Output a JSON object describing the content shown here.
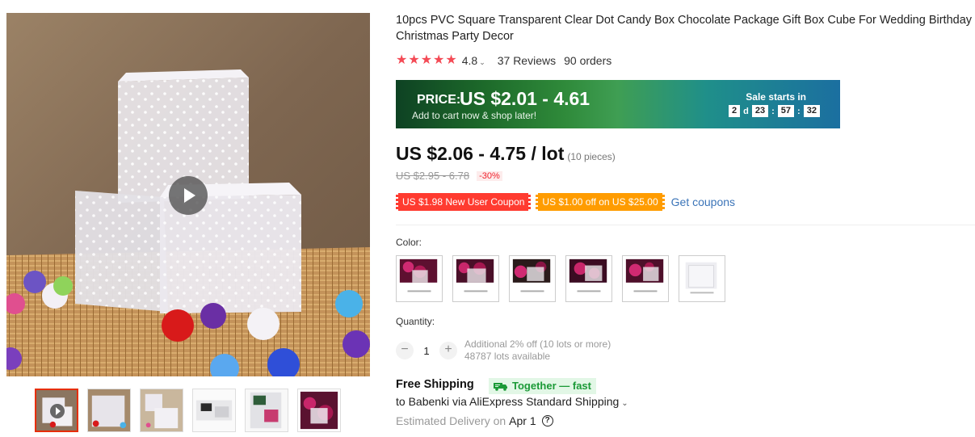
{
  "product": {
    "title": "10pcs PVC Square Transparent Clear Dot Candy Box Chocolate Package Gift Box Cube For Wedding Birthday Christmas Party Decor",
    "rating": "4.8",
    "stars": 5,
    "reviews": "37 Reviews",
    "orders": "90 orders"
  },
  "promo": {
    "price_label": "PRICE:",
    "price_value": "US $2.01 - 4.61",
    "subtitle": "Add to cart now & shop later!",
    "sale_title": "Sale starts in",
    "countdown": {
      "days": "2",
      "days_unit": "d",
      "hours": "23",
      "minutes": "57",
      "seconds": "32"
    }
  },
  "price": {
    "current": "US $2.06 - 4.75 / lot",
    "pieces": "(10 pieces)",
    "original": "US $2.95 - 6.78",
    "discount": "-30%"
  },
  "coupons": {
    "new_user": "US $1.98 New User Coupon",
    "store": "US $1.00 off on US $25.00",
    "get": "Get coupons"
  },
  "color": {
    "label": "Color:",
    "options": [
      "swatch-1",
      "swatch-2",
      "swatch-3",
      "swatch-4",
      "swatch-5",
      "swatch-6"
    ]
  },
  "quantity": {
    "label": "Quantity:",
    "value": "1",
    "minus": "−",
    "plus": "+",
    "note1": "Additional 2% off (10 lots or more)",
    "note2": "48787 lots available"
  },
  "shipping": {
    "title": "Free Shipping",
    "badge": "Together — fast",
    "dest": "to Babenki via AliExpress Standard Shipping",
    "delivery_label": "Estimated Delivery on",
    "delivery_date": "Apr 1",
    "help": "?"
  },
  "colors": {
    "star": "#f44a55",
    "coupon_red": "#ff3b30",
    "coupon_orange": "#ff9c00",
    "link": "#3b74b8",
    "together_bg": "#e2f7e6",
    "together_fg": "#1b9a37"
  }
}
